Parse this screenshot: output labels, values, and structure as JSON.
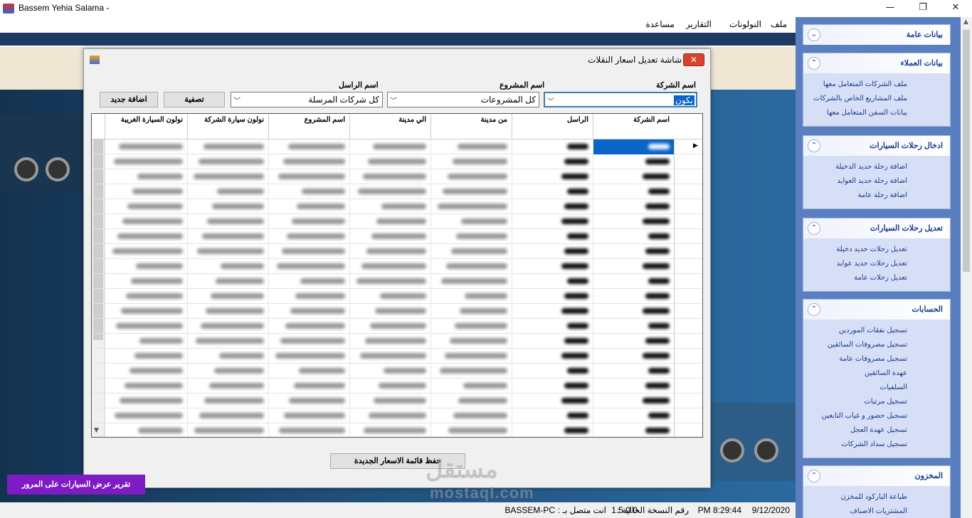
{
  "window": {
    "title": "Bassem Yehia Salama -",
    "minimize": "—",
    "maximize": "❐",
    "close": "✕"
  },
  "menu": [
    "ملف",
    "النولونات",
    "التقارير",
    "مساعدة"
  ],
  "dialog": {
    "title": "شاشة تعديل اسعار النقلات",
    "close": "✕",
    "company_label": "اسم الشركة",
    "company_value": "بكون",
    "project_label": "اسم المشروع",
    "project_value": "كل المشروعات",
    "sender_label": "اسم الراسل",
    "sender_value": "كل شركات المرسلة",
    "filter_button": "تصفية",
    "add_button": "اضافة جديد",
    "save_button": "حفظ قائمة الاسعار الجديدة",
    "columns": [
      "اسم الشركة",
      "الراسل",
      "من مدينة",
      "الي مدينة",
      "اسم المشروع",
      "نولون سيارة الشركة",
      "نولون السيارة الغريبة"
    ]
  },
  "report_button": "تقرير عرض السيارات على المرور",
  "watermark": {
    "arabic": "مستقل",
    "latin": "mostaql.com"
  },
  "status": {
    "date": "9/12/2020",
    "time": "8:29:44 PM",
    "version_label": "رقم النسخة الحالية :",
    "version": "1.5.0.0",
    "connected_label": "انت متصل بـ :",
    "machine": "BASSEM-PC"
  },
  "sidebar": [
    {
      "title": "بيانات عامة",
      "items": [],
      "chev": "⌄"
    },
    {
      "title": "بيانات العملاء",
      "chev": "⌃",
      "items": [
        "ملف الشركات المتعامل معها",
        "ملف المشاريع الخاص بالشركات",
        "بيانات السفن المتعامل معها"
      ]
    },
    {
      "title": "ادخال رحلات السيارات",
      "chev": "⌃",
      "items": [
        "اضافة رحلة حديد الدخيلة",
        "اضافة رحلة حديد العوايد",
        "اضافة رحلة عامة"
      ]
    },
    {
      "title": "تعديل رحلات السيارات",
      "chev": "⌃",
      "items": [
        "تعديل رحلات حديد دخيلة",
        "تعديل رحلات حديد عوايد",
        "تعديل رحلات عامة"
      ]
    },
    {
      "title": "الحسابات",
      "chev": "⌃",
      "items": [
        "تسجيل نفقات الموردين",
        "تسجيل مصروفات السائقين",
        "تسجيل مصروفات عامة",
        "عهدة السائقين",
        "السلفيات",
        "تسجيل مرتبات",
        "تسجيل حضور و غياب التابعين",
        "تسجيل عهدة العجل",
        "تسجيل سداد الشركات"
      ]
    },
    {
      "title": "المخزون",
      "chev": "⌃",
      "items": [
        "طباعة الباركود للمخزن",
        "المشتريات الاصناف"
      ]
    }
  ]
}
